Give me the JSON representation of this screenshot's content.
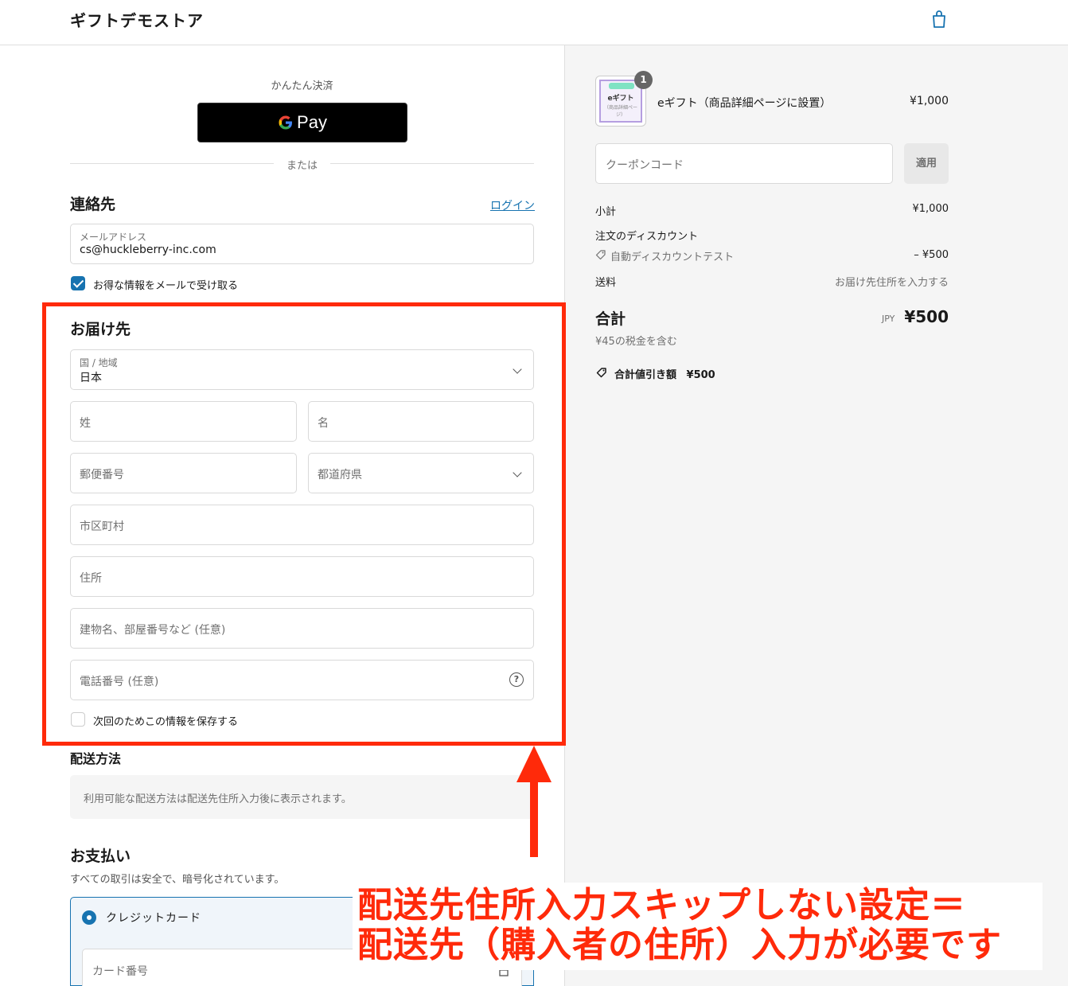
{
  "header": {
    "store_name": "ギフトデモストア",
    "cart_icon": "shopping-bag-icon"
  },
  "express": {
    "label": "かんたん決済",
    "gpay_label": "Pay",
    "or_text": "または"
  },
  "contact": {
    "title": "連絡先",
    "login_link": "ログイン",
    "email_label": "メールアドレス",
    "email_value": "cs@huckleberry-inc.com",
    "newsletter_label": "お得な情報をメールで受け取る",
    "newsletter_checked": true
  },
  "delivery": {
    "title": "お届け先",
    "country_label": "国 / 地域",
    "country_value": "日本",
    "last_name_placeholder": "姓",
    "first_name_placeholder": "名",
    "postal_placeholder": "郵便番号",
    "prefecture_placeholder": "都道府県",
    "city_placeholder": "市区町村",
    "address_placeholder": "住所",
    "building_placeholder": "建物名、部屋番号など (任意)",
    "phone_placeholder": "電話番号 (任意)",
    "save_info_label": "次回のためこの情報を保存する",
    "save_info_checked": false
  },
  "shipping": {
    "title": "配送方法",
    "notice": "利用可能な配送方法は配送先住所入力後に表示されます。"
  },
  "payment": {
    "title": "お支払い",
    "subtitle": "すべての取引は安全で、暗号化されています。",
    "method_label": "クレジットカード",
    "card_number_placeholder": "カード番号"
  },
  "annotation": {
    "line1": "配送先住所入力スキップしない設定＝",
    "line2": "配送先（購入者の住所）入力が必要です",
    "color": "#ff2a0a"
  },
  "summary": {
    "thumb_title": "eギフト",
    "thumb_sub": "（商品詳細ページ）",
    "quantity": "1",
    "product_name": "eギフト（商品詳細ページに設置）",
    "product_price": "¥1,000",
    "coupon_placeholder": "クーポンコード",
    "apply_label": "適用",
    "subtotal_label": "小計",
    "subtotal_value": "¥1,000",
    "order_discount_label": "注文のディスカウント",
    "discount_name": "自動ディスカウントテスト",
    "discount_value": "– ¥500",
    "shipping_label": "送料",
    "shipping_value": "お届け先住所を入力する",
    "total_label": "合計",
    "currency": "JPY",
    "total_value": "¥500",
    "tax_note": "¥45の税金を含む",
    "savings_label": "合計値引き額",
    "savings_value": "¥500"
  },
  "colors": {
    "accent": "#1773b0",
    "annotation": "#ff2a0a"
  }
}
